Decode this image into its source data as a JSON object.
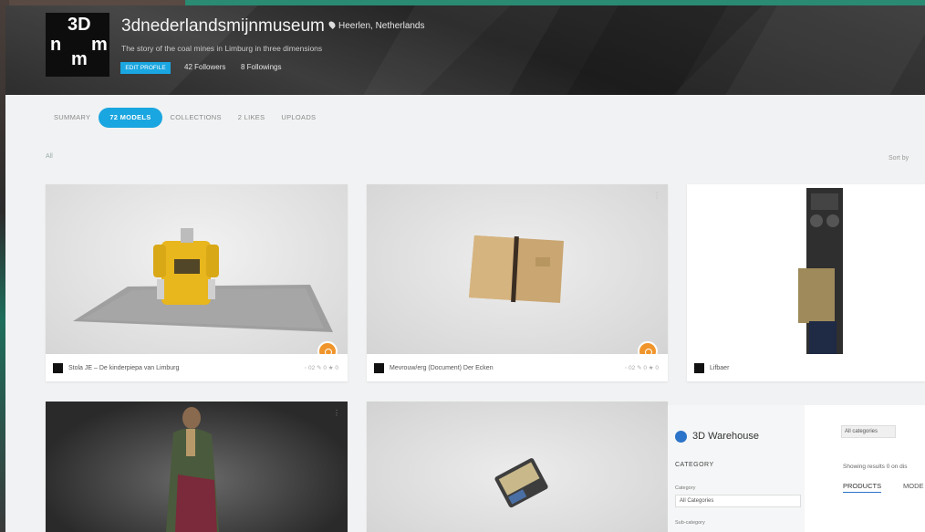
{
  "profile": {
    "name": "3dnederlandsmijnmuseum",
    "location": "Heerlen, Netherlands",
    "tagline": "The story of the coal mines in Limburg in three dimensions",
    "edit_label": "EDIT PROFILE",
    "followers": "42 Followers",
    "following": "8 Followings",
    "logo_lines": [
      "3D",
      "n",
      "m",
      "m"
    ]
  },
  "tabs": [
    {
      "label": "SUMMARY"
    },
    {
      "label": "72 MODELS"
    },
    {
      "label": "COLLECTIONS"
    },
    {
      "label": "2 LIKES"
    },
    {
      "label": "UPLOADS"
    }
  ],
  "filter": {
    "left": "All",
    "right": "Sort by"
  },
  "cards": [
    {
      "title": "Stola JE – De kinderpiepa van Limburg",
      "stats": "◦ 02  ✎ 0  ★ 0"
    },
    {
      "title": "Mevrouw/erg (Document) Der Ecken",
      "stats": "◦ 02  ✎ 0  ★ 0"
    },
    {
      "title": "Lifbaer",
      "stats": ""
    },
    {
      "title": "",
      "stats": ""
    },
    {
      "title": "",
      "stats": ""
    }
  ],
  "warehouse": {
    "title": "3D Warehouse",
    "category": "CATEGORY",
    "label1": "Category",
    "select1": "All Categories",
    "label2": "Sub-category",
    "right_select": "All categories",
    "showing": "Showing results 0 on dis",
    "products": "PRODUCTS",
    "models": "MODE"
  },
  "colors": {
    "accent": "#1aa6e0",
    "badge": "#f0952b",
    "header": "#2e2e2e"
  }
}
